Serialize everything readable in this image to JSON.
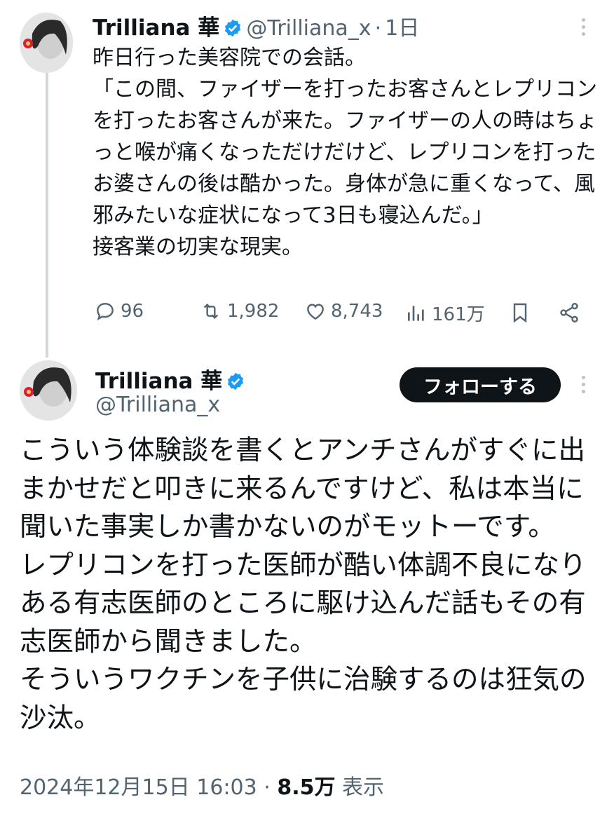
{
  "tweet1": {
    "display_name": "Trilliana 華",
    "handle": "@Trilliana_x",
    "separator": "·",
    "time": "1日",
    "text": "昨日行った美容院での会話。\n「この間、ファイザーを打ったお客さんとレプリコンを打ったお客さんが来た。ファイザーの人の時はちょっと喉が痛くなっただけだけど、レプリコンを打ったお婆さんの後は酷かった。身体が急に重くなって、風邪みたいな症状になって3日も寝込んだ。」\n接客業の切実な現実。",
    "actions": {
      "replies": "96",
      "retweets": "1,982",
      "likes": "8,743",
      "views": "161万"
    }
  },
  "tweet2": {
    "display_name": "Trilliana 華",
    "handle": "@Trilliana_x",
    "follow_label": "フォローする",
    "text": "こういう体験談を書くとアンチさんがすぐに出まかせだと叩きに来るんですけど、私は本当に聞いた事実しか書かないのがモットーです。\nレプリコンを打った医師が酷い体調不良になりある有志医師のところに駆け込んだ話もその有志医師から聞きました。\nそういうワクチンを子供に治験するのは狂気の沙汰。",
    "timestamp": "2024年12月15日 16:03",
    "separator": "·",
    "views": "8.5万",
    "views_label": "表示"
  },
  "colors": {
    "text": "#0f1419",
    "secondary": "#536471",
    "verified": "#1d9bf0",
    "thread_line": "#cfd9de",
    "button_bg": "#0f1419"
  },
  "icons": [
    "verified-badge-icon",
    "more-icon",
    "reply-icon",
    "retweet-icon",
    "like-icon",
    "views-icon",
    "bookmark-icon",
    "share-icon"
  ]
}
